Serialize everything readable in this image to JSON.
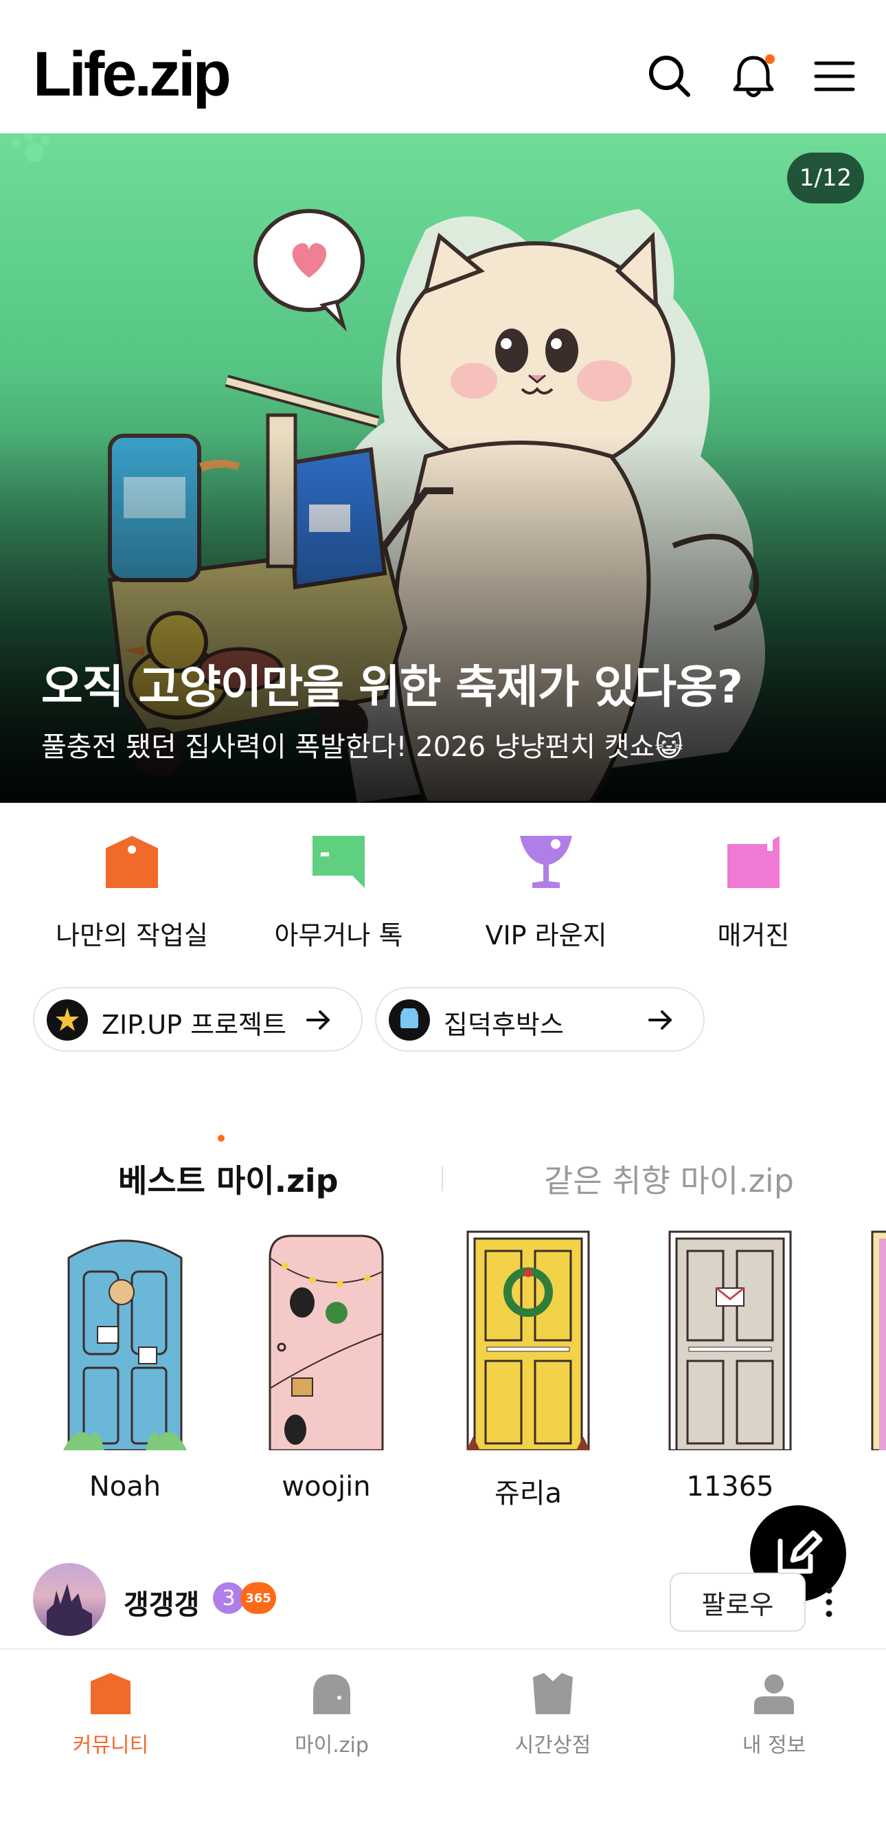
{
  "header": {
    "logo": "Life.zip",
    "icons": [
      "search-icon",
      "bell-icon",
      "menu-icon"
    ],
    "notification_dot_color": "#ff6a1a"
  },
  "hero": {
    "counter": "1/12",
    "title": "오직 고양이만을 위한 축제가 있다옹?",
    "subtitle": "풀충전 됐던 집사력이 폭발한다! 2026 냥냥펀치 캣쇼😺",
    "background_colors": [
      "#6fdc98",
      "#0b1d14"
    ]
  },
  "quick_menu": [
    {
      "label": "나만의 작업실",
      "icon": "studio-icon",
      "color": "#f06a2a"
    },
    {
      "label": "아무거나 톡",
      "icon": "chat-icon",
      "color": "#5fd07f"
    },
    {
      "label": "VIP 라운지",
      "icon": "cocktail-icon",
      "color": "#b07ee8"
    },
    {
      "label": "매거진",
      "icon": "magazine-icon",
      "color": "#f07ad3"
    }
  ],
  "pills": [
    {
      "label": "ZIP.UP 프로젝트",
      "icon": "star-icon"
    },
    {
      "label": "집덕후박스",
      "icon": "box-icon"
    }
  ],
  "tabs": {
    "active": "베스트 마이.zip",
    "inactive": "같은 취향 마이.zip"
  },
  "doors": [
    {
      "label": "Noah",
      "color": "#6bb7d8"
    },
    {
      "label": "woojin",
      "color": "#f6c9c9"
    },
    {
      "label": "쥬리a",
      "color": "#f2d248"
    },
    {
      "label": "11365",
      "color": "#d9d3c8"
    }
  ],
  "post": {
    "author": "갱갱갱",
    "level": "3",
    "badge": "365",
    "follow_label": "팔로우"
  },
  "bottom_nav": [
    {
      "label": "커뮤니티",
      "active": true
    },
    {
      "label": "마이.zip",
      "active": false
    },
    {
      "label": "시간상점",
      "active": false
    },
    {
      "label": "내 정보",
      "active": false
    }
  ],
  "accent_color": "#f06a2a"
}
